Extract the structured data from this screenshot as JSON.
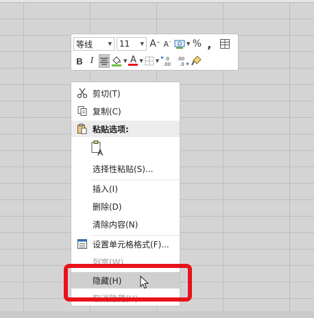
{
  "mini_toolbar": {
    "font_name": "等线",
    "font_size": "11",
    "percent_label": "%",
    "comma_label": ",",
    "bold_label": "B",
    "italic_label": "I",
    "grow_font_label": "A",
    "shrink_font_label": "A",
    "font_color_label": "A"
  },
  "context_menu": {
    "items": [
      {
        "label": "剪切(T)",
        "icon": "scissors-icon"
      },
      {
        "label": "复制(C)",
        "icon": "copy-icon"
      },
      {
        "label": "粘贴选项:",
        "icon": "paste-icon"
      },
      {
        "label": "选择性粘贴(S)...",
        "icon": ""
      },
      {
        "label": "插入(I)",
        "icon": ""
      },
      {
        "label": "删除(D)",
        "icon": ""
      },
      {
        "label": "清除内容(N)",
        "icon": ""
      },
      {
        "label": "设置单元格格式(F)...",
        "icon": "format-cells-icon"
      },
      {
        "label": "列宽(W)...",
        "icon": ""
      },
      {
        "label": "隐藏(H)",
        "icon": ""
      },
      {
        "label": "取消隐藏(U)",
        "icon": ""
      }
    ]
  },
  "colors": {
    "highlight_box": "#e8121b",
    "fill_color": "#6fbf3c",
    "font_color": "#e8121b",
    "menu_hover": "#cfcfcf"
  }
}
